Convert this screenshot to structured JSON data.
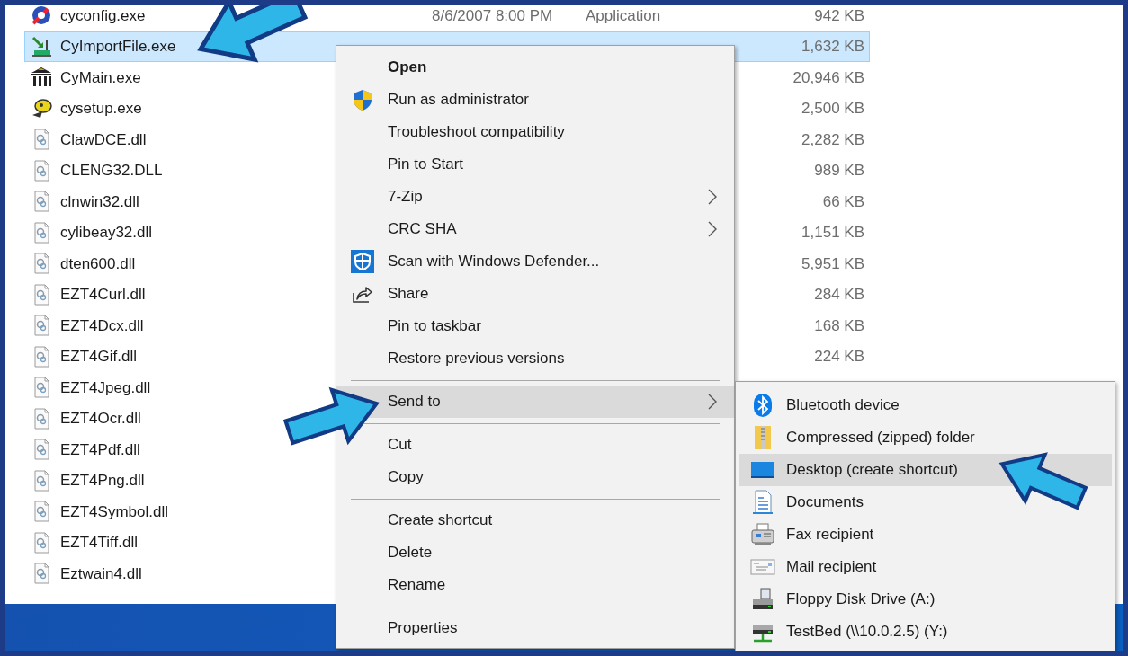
{
  "files": [
    {
      "kind": "config",
      "name": "cyconfig.exe",
      "date": "8/6/2007 8:00 PM",
      "type": "Application",
      "size": "942 KB",
      "selected": false
    },
    {
      "kind": "import",
      "name": "CyImportFile.exe",
      "size": "1,632 KB",
      "selected": true
    },
    {
      "kind": "bank",
      "name": "CyMain.exe",
      "size": "20,946 KB",
      "selected": false
    },
    {
      "kind": "setup",
      "name": "cysetup.exe",
      "size": "2,500 KB",
      "selected": false
    },
    {
      "kind": "dll",
      "name": "ClawDCE.dll",
      "size": "2,282 KB",
      "selected": false
    },
    {
      "kind": "dll",
      "name": "CLENG32.DLL",
      "size": "989 KB",
      "selected": false
    },
    {
      "kind": "dll",
      "name": "clnwin32.dll",
      "size": "66 KB",
      "selected": false
    },
    {
      "kind": "dll",
      "name": "cylibeay32.dll",
      "size": "1,151 KB",
      "selected": false
    },
    {
      "kind": "dll",
      "name": "dten600.dll",
      "size": "5,951 KB",
      "selected": false
    },
    {
      "kind": "dll",
      "name": "EZT4Curl.dll",
      "size": "284 KB",
      "selected": false
    },
    {
      "kind": "dll",
      "name": "EZT4Dcx.dll",
      "size": "168 KB",
      "selected": false
    },
    {
      "kind": "dll",
      "name": "EZT4Gif.dll",
      "size": "224 KB",
      "selected": false
    },
    {
      "kind": "dll",
      "name": "EZT4Jpeg.dll",
      "selected": false
    },
    {
      "kind": "dll",
      "name": "EZT4Ocr.dll",
      "selected": false
    },
    {
      "kind": "dll",
      "name": "EZT4Pdf.dll",
      "selected": false
    },
    {
      "kind": "dll",
      "name": "EZT4Png.dll",
      "selected": false
    },
    {
      "kind": "dll",
      "name": "EZT4Symbol.dll",
      "selected": false
    },
    {
      "kind": "dll",
      "name": "EZT4Tiff.dll",
      "selected": false
    },
    {
      "kind": "dll",
      "name": "Eztwain4.dll",
      "selected": false
    }
  ],
  "context_menu": {
    "groups": [
      [
        {
          "kind": "plain",
          "label": "Open",
          "default": true,
          "submenu": false,
          "selected": false
        },
        {
          "kind": "shield",
          "label": "Run as administrator",
          "default": false,
          "submenu": false,
          "selected": false
        },
        {
          "kind": "plain",
          "label": "Troubleshoot compatibility",
          "default": false,
          "submenu": false,
          "selected": false
        },
        {
          "kind": "plain",
          "label": "Pin to Start",
          "default": false,
          "submenu": false,
          "selected": false
        },
        {
          "kind": "plain",
          "label": "7-Zip",
          "default": false,
          "submenu": true,
          "selected": false
        },
        {
          "kind": "plain",
          "label": "CRC SHA",
          "default": false,
          "submenu": true,
          "selected": false
        },
        {
          "kind": "defender",
          "label": "Scan with Windows Defender...",
          "default": false,
          "submenu": false,
          "selected": false
        },
        {
          "kind": "share",
          "label": "Share",
          "default": false,
          "submenu": false,
          "selected": false
        },
        {
          "kind": "plain",
          "label": "Pin to taskbar",
          "default": false,
          "submenu": false,
          "selected": false
        },
        {
          "kind": "plain",
          "label": "Restore previous versions",
          "default": false,
          "submenu": false,
          "selected": false
        }
      ],
      [
        {
          "kind": "plain",
          "label": "Send to",
          "default": false,
          "submenu": true,
          "selected": true
        }
      ],
      [
        {
          "kind": "plain",
          "label": "Cut",
          "default": false,
          "submenu": false,
          "selected": false
        },
        {
          "kind": "plain",
          "label": "Copy",
          "default": false,
          "submenu": false,
          "selected": false
        }
      ],
      [
        {
          "kind": "plain",
          "label": "Create shortcut",
          "default": false,
          "submenu": false,
          "selected": false
        },
        {
          "kind": "plain",
          "label": "Delete",
          "default": false,
          "submenu": false,
          "selected": false
        },
        {
          "kind": "plain",
          "label": "Rename",
          "default": false,
          "submenu": false,
          "selected": false
        }
      ],
      [
        {
          "kind": "plain",
          "label": "Properties",
          "default": false,
          "submenu": false,
          "selected": false
        }
      ]
    ]
  },
  "send_to_menu": {
    "items": [
      {
        "kind": "bluetooth",
        "label": "Bluetooth device",
        "selected": false
      },
      {
        "kind": "zip",
        "label": "Compressed (zipped) folder",
        "selected": false
      },
      {
        "kind": "desktop",
        "label": "Desktop (create shortcut)",
        "selected": true
      },
      {
        "kind": "documents",
        "label": "Documents",
        "selected": false
      },
      {
        "kind": "fax",
        "label": "Fax recipient",
        "selected": false
      },
      {
        "kind": "mail",
        "label": "Mail recipient",
        "selected": false
      },
      {
        "kind": "floppy",
        "label": "Floppy Disk Drive (A:)",
        "selected": false
      },
      {
        "kind": "network",
        "label": "TestBed (\\\\10.0.2.5) (Y:)",
        "selected": false
      }
    ]
  }
}
